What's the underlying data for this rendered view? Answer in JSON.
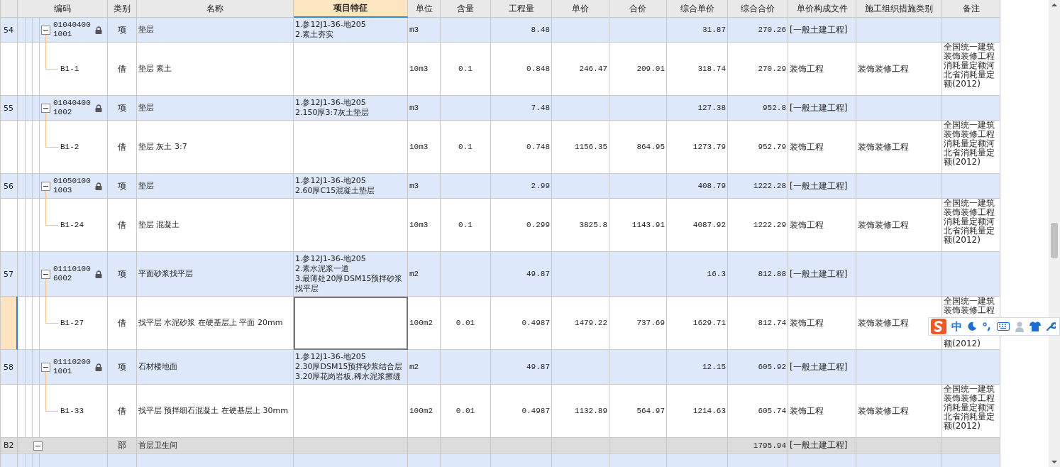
{
  "columns": [
    {
      "selected": false
    },
    {
      "label": "编码",
      "selected": false
    },
    {
      "label": "类别",
      "selected": false
    },
    {
      "label": "名称",
      "selected": false
    },
    {
      "label": "项目特征",
      "selected": true
    },
    {
      "label": "单位",
      "selected": false
    },
    {
      "label": "含量",
      "selected": false
    },
    {
      "label": "工程量",
      "selected": false
    },
    {
      "label": "单价",
      "selected": false
    },
    {
      "label": "合价",
      "selected": false
    },
    {
      "label": "综合单价",
      "selected": false
    },
    {
      "label": "综合合价",
      "selected": false
    },
    {
      "label": "单价构成文件",
      "selected": false
    },
    {
      "label": "施工组织措施类别",
      "selected": false
    },
    {
      "label": "备注",
      "selected": false
    }
  ],
  "rows": [
    {
      "kind": "item",
      "num": "54",
      "selected": false,
      "expanded": true,
      "locked": true,
      "code_lines": [
        "01040400",
        "1001"
      ],
      "type": "项",
      "name": "垫层",
      "features": [
        "1.参12J1-36-地205",
        "2.素土夯实"
      ],
      "unit": "m3",
      "qty": "8.48",
      "comp_price": "31.87",
      "comp_total": "270.26",
      "file": "[一般土建工程]"
    },
    {
      "kind": "sub",
      "selected": false,
      "code": "B1-1",
      "type": "借",
      "name": "垫层 素土",
      "unit": "10m3",
      "ratio": "0.1",
      "qty": "0.848",
      "price": "246.47",
      "total": "209.01",
      "comp_price": "318.74",
      "comp_total": "270.29",
      "file": "装饰工程",
      "org": "装饰装修工程",
      "remark": "全国统一建筑装饰装修工程消耗量定额河北省消耗量定额(2012)"
    },
    {
      "kind": "item",
      "num": "55",
      "selected": false,
      "expanded": true,
      "locked": true,
      "code_lines": [
        "01040400",
        "1002"
      ],
      "type": "项",
      "name": "垫层",
      "features": [
        "1.参12J1-36-地205",
        "2.150厚3:7灰土垫层"
      ],
      "unit": "m3",
      "qty": "7.48",
      "comp_price": "127.38",
      "comp_total": "952.8",
      "file": "[一般土建工程]"
    },
    {
      "kind": "sub",
      "selected": false,
      "code": "B1-2",
      "type": "借",
      "name": "垫层 灰土 3:7",
      "unit": "10m3",
      "ratio": "0.1",
      "qty": "0.748",
      "price": "1156.35",
      "total": "864.95",
      "comp_price": "1273.79",
      "comp_total": "952.79",
      "file": "装饰工程",
      "org": "装饰装修工程",
      "remark": "全国统一建筑装饰装修工程消耗量定额河北省消耗量定额(2012)"
    },
    {
      "kind": "item",
      "num": "56",
      "selected": false,
      "expanded": true,
      "locked": true,
      "code_lines": [
        "01050100",
        "1003"
      ],
      "type": "项",
      "name": "垫层",
      "features": [
        "1.参12J1-36-地205",
        "2.60厚C15混凝土垫层"
      ],
      "unit": "m3",
      "qty": "2.99",
      "comp_price": "408.79",
      "comp_total": "1222.28",
      "file": "[一般土建工程]"
    },
    {
      "kind": "sub",
      "selected": false,
      "code": "B1-24",
      "type": "借",
      "name": "垫层 混凝土",
      "unit": "10m3",
      "ratio": "0.1",
      "qty": "0.299",
      "price": "3825.8",
      "total": "1143.91",
      "comp_price": "4087.92",
      "comp_total": "1222.29",
      "file": "装饰工程",
      "org": "装饰装修工程",
      "remark": "全国统一建筑装饰装修工程消耗量定额河北省消耗量定额(2012)"
    },
    {
      "kind": "item",
      "num": "57",
      "selected": false,
      "expanded": true,
      "locked": true,
      "code_lines": [
        "01110100",
        "6002"
      ],
      "type": "项",
      "name": "平面砂浆找平层",
      "features": [
        "1.参12J1-36-地205",
        "2.素水泥浆一道",
        "3.最薄处20厚DSM15预拌砂浆找平层"
      ],
      "unit": "m2",
      "qty": "49.87",
      "comp_price": "16.3",
      "comp_total": "812.88",
      "file": "[一般土建工程]"
    },
    {
      "kind": "sub",
      "selected": true,
      "code": "B1-27",
      "type": "借",
      "name": "找平层 水泥砂浆 在硬基层上 平面 20mm",
      "unit": "100m2",
      "ratio": "0.01",
      "qty": "0.4987",
      "price": "1479.22",
      "total": "737.69",
      "comp_price": "1629.71",
      "comp_total": "812.74",
      "file": "装饰工程",
      "org": "装饰装修工程",
      "remark_top": "全国统一建筑装饰装修工程",
      "remark_bottom": "额(2012)"
    },
    {
      "kind": "item",
      "num": "58",
      "selected": false,
      "expanded": true,
      "locked": true,
      "code_lines": [
        "01110200",
        "1001"
      ],
      "type": "项",
      "name": "石材楼地面",
      "features": [
        "1.参12J1-36-地205",
        "2.30厚DSM15预拌砂浆结合层",
        "3.20厚花岗岩板,稀水泥浆擦缝"
      ],
      "unit": "m2",
      "qty": "49.87",
      "comp_price": "12.15",
      "comp_total": "605.92",
      "file": "[一般土建工程]"
    },
    {
      "kind": "sub",
      "selected": false,
      "code": "B1-33",
      "type": "借",
      "name": "找平层 预拌细石混凝土 在硬基层上 30mm",
      "unit": "100m2",
      "ratio": "0.01",
      "qty": "0.4987",
      "price": "1132.89",
      "total": "564.97",
      "comp_price": "1214.63",
      "comp_total": "605.74",
      "file": "装饰工程",
      "org": "装饰装修工程",
      "remark": "全国统一建筑装饰装修工程消耗量定额河北省消耗量定额(2012)"
    },
    {
      "kind": "section",
      "num": "B2",
      "selected": false,
      "expanded": true,
      "type": "部",
      "name": "首层卫生间",
      "comp_total": "1795.94",
      "file": "[一般土建工程]"
    },
    {
      "kind": "item",
      "selected": false
    }
  ],
  "ime": {
    "mode": "中"
  }
}
